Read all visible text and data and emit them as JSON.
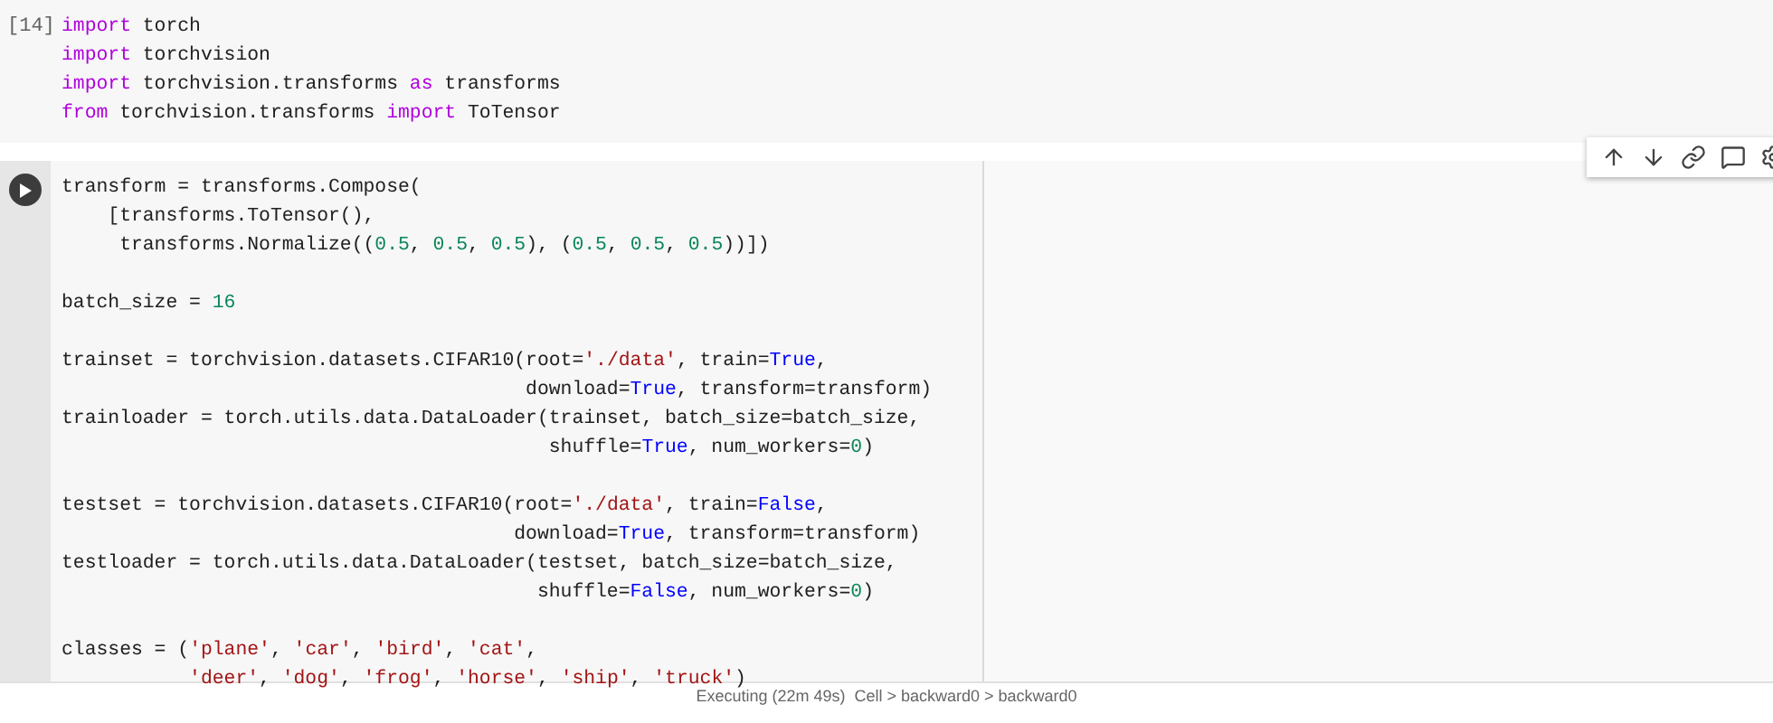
{
  "cells": [
    {
      "kind": "executed",
      "prompt": "[14]",
      "lines": [
        [
          {
            "kind": "keyword",
            "text": "import"
          },
          {
            "kind": "plain",
            "text": " torch"
          }
        ],
        [
          {
            "kind": "keyword",
            "text": "import"
          },
          {
            "kind": "plain",
            "text": " torchvision"
          }
        ],
        [
          {
            "kind": "keyword",
            "text": "import"
          },
          {
            "kind": "plain",
            "text": " torchvision.transforms "
          },
          {
            "kind": "keyword",
            "text": "as"
          },
          {
            "kind": "plain",
            "text": " transforms"
          }
        ],
        [
          {
            "kind": "keyword",
            "text": "from"
          },
          {
            "kind": "plain",
            "text": " torchvision.transforms "
          },
          {
            "kind": "keyword",
            "text": "import"
          },
          {
            "kind": "plain",
            "text": " ToTensor"
          }
        ]
      ]
    },
    {
      "kind": "active",
      "lines": [
        [
          {
            "kind": "plain",
            "text": "transform = transforms.Compose("
          }
        ],
        [
          {
            "kind": "plain",
            "text": "    [transforms.ToTensor(),"
          }
        ],
        [
          {
            "kind": "plain",
            "text": "     transforms.Normalize(("
          },
          {
            "kind": "number",
            "text": "0.5"
          },
          {
            "kind": "plain",
            "text": ", "
          },
          {
            "kind": "number",
            "text": "0.5"
          },
          {
            "kind": "plain",
            "text": ", "
          },
          {
            "kind": "number",
            "text": "0.5"
          },
          {
            "kind": "plain",
            "text": "), ("
          },
          {
            "kind": "number",
            "text": "0.5"
          },
          {
            "kind": "plain",
            "text": ", "
          },
          {
            "kind": "number",
            "text": "0.5"
          },
          {
            "kind": "plain",
            "text": ", "
          },
          {
            "kind": "number",
            "text": "0.5"
          },
          {
            "kind": "plain",
            "text": "))])"
          }
        ],
        {
          "kind": "blank"
        },
        [
          {
            "kind": "plain",
            "text": "batch_size = "
          },
          {
            "kind": "number",
            "text": "16"
          }
        ],
        {
          "kind": "blank"
        },
        [
          {
            "kind": "plain",
            "text": "trainset = torchvision.datasets.CIFAR10(root="
          },
          {
            "kind": "string",
            "text": "'./data'"
          },
          {
            "kind": "plain",
            "text": ", train="
          },
          {
            "kind": "constant",
            "text": "True"
          },
          {
            "kind": "plain",
            "text": ","
          }
        ],
        [
          {
            "kind": "plain",
            "text": "                                        download="
          },
          {
            "kind": "constant",
            "text": "True"
          },
          {
            "kind": "plain",
            "text": ", transform=transform)"
          }
        ],
        [
          {
            "kind": "plain",
            "text": "trainloader = torch.utils.data.DataLoader(trainset, batch_size=batch_size,"
          }
        ],
        [
          {
            "kind": "plain",
            "text": "                                          shuffle="
          },
          {
            "kind": "constant",
            "text": "True"
          },
          {
            "kind": "plain",
            "text": ", num_workers="
          },
          {
            "kind": "number",
            "text": "0"
          },
          {
            "kind": "plain",
            "text": ")"
          }
        ],
        {
          "kind": "blank"
        },
        [
          {
            "kind": "plain",
            "text": "testset = torchvision.datasets.CIFAR10(root="
          },
          {
            "kind": "string",
            "text": "'./data'"
          },
          {
            "kind": "plain",
            "text": ", train="
          },
          {
            "kind": "constant",
            "text": "False"
          },
          {
            "kind": "plain",
            "text": ","
          }
        ],
        [
          {
            "kind": "plain",
            "text": "                                       download="
          },
          {
            "kind": "constant",
            "text": "True"
          },
          {
            "kind": "plain",
            "text": ", transform=transform)"
          }
        ],
        [
          {
            "kind": "plain",
            "text": "testloader = torch.utils.data.DataLoader(testset, batch_size=batch_size,"
          }
        ],
        [
          {
            "kind": "plain",
            "text": "                                         shuffle="
          },
          {
            "kind": "constant",
            "text": "False"
          },
          {
            "kind": "plain",
            "text": ", num_workers="
          },
          {
            "kind": "number",
            "text": "0"
          },
          {
            "kind": "plain",
            "text": ")"
          }
        ],
        {
          "kind": "blank"
        },
        [
          {
            "kind": "plain",
            "text": "classes = ("
          },
          {
            "kind": "string",
            "text": "'plane'"
          },
          {
            "kind": "plain",
            "text": ", "
          },
          {
            "kind": "string",
            "text": "'car'"
          },
          {
            "kind": "plain",
            "text": ", "
          },
          {
            "kind": "string",
            "text": "'bird'"
          },
          {
            "kind": "plain",
            "text": ", "
          },
          {
            "kind": "string",
            "text": "'cat'"
          },
          {
            "kind": "plain",
            "text": ","
          }
        ],
        [
          {
            "kind": "string",
            "text": "           'deer'"
          },
          {
            "kind": "plain",
            "text": ", "
          },
          {
            "kind": "string",
            "text": "'dog'"
          },
          {
            "kind": "plain",
            "text": ", "
          },
          {
            "kind": "string",
            "text": "'frog'"
          },
          {
            "kind": "plain",
            "text": ", "
          },
          {
            "kind": "string",
            "text": "'horse'"
          },
          {
            "kind": "plain",
            "text": ", "
          },
          {
            "kind": "string",
            "text": "'ship'"
          },
          {
            "kind": "plain",
            "text": ", "
          },
          {
            "kind": "string",
            "text": "'truck'"
          },
          {
            "kind": "plain",
            "text": ")"
          }
        ]
      ]
    }
  ],
  "status_bar": {
    "text": "Executing (22m 49s)  Cell > backward0 > backward0"
  }
}
